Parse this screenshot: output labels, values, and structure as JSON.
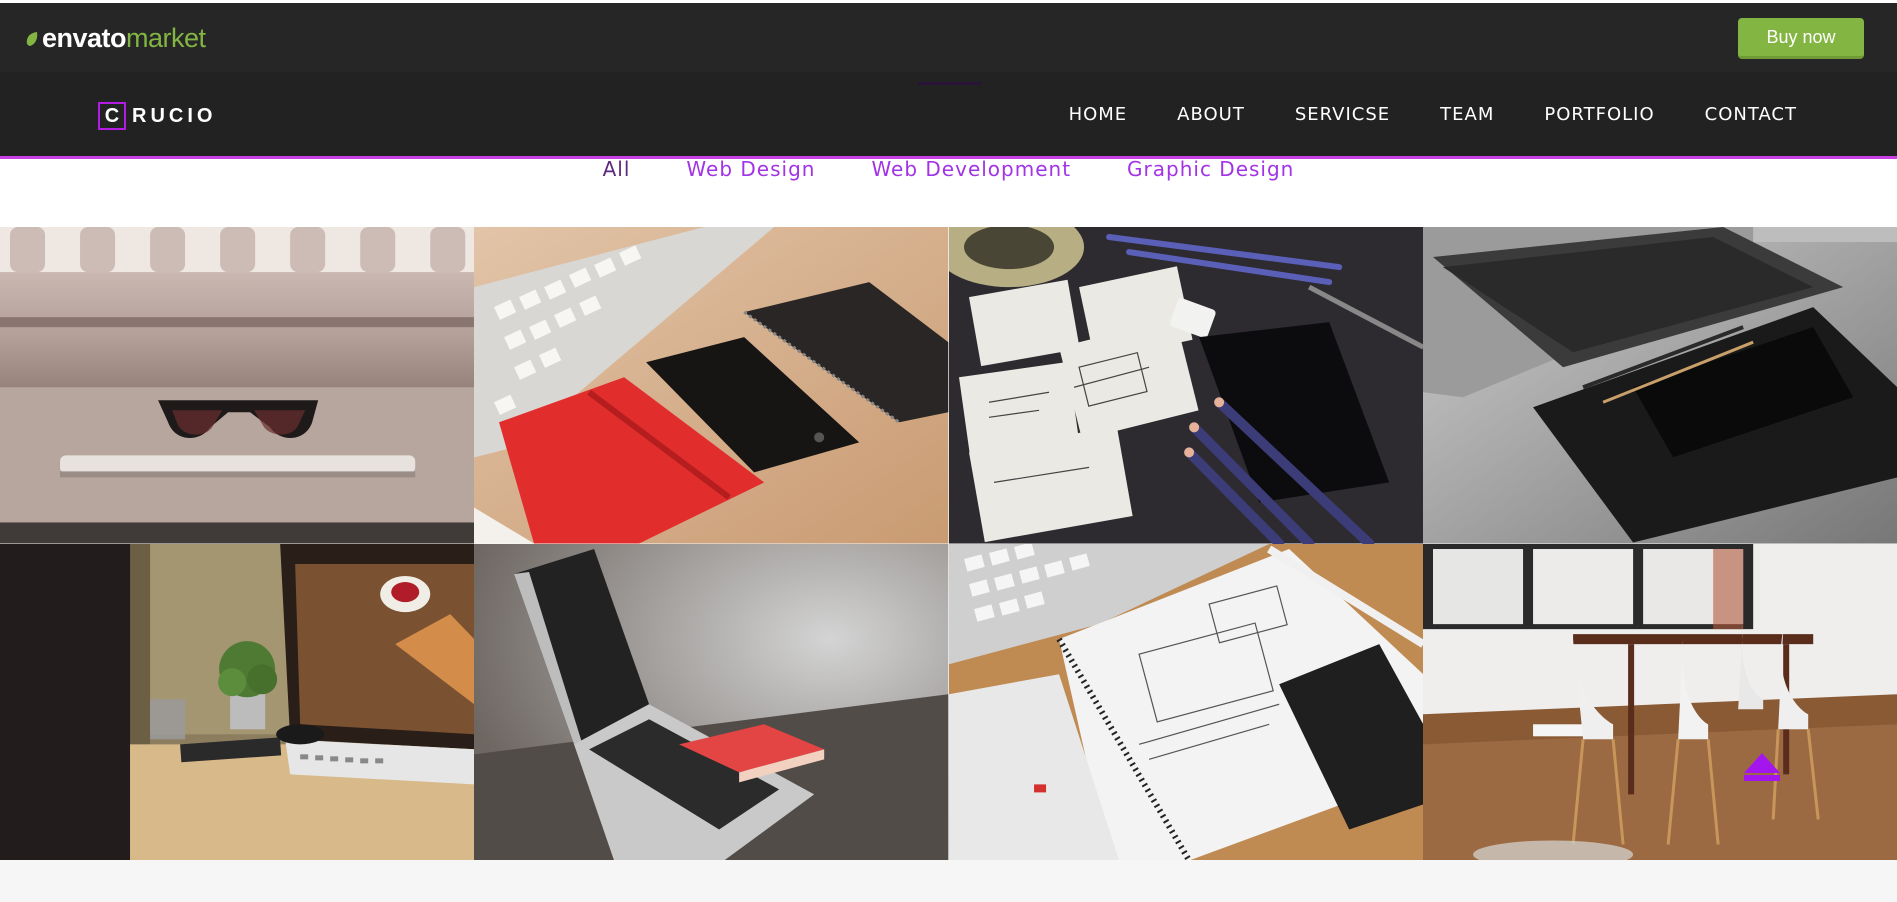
{
  "envato": {
    "brand_main": "envato",
    "brand_suffix": "market",
    "buy_label": "Buy now",
    "brand_color": "#82b541"
  },
  "site": {
    "logo_letter": "C",
    "logo_text": "RUCIO",
    "accent_color": "#b31ce6",
    "menu": [
      "HOME",
      "ABOUT",
      "SERVICSE",
      "TEAM",
      "PORTFOLIO",
      "CONTACT"
    ]
  },
  "portfolio": {
    "filters": [
      "All",
      "Web Design",
      "Web Development",
      "Graphic Design"
    ],
    "active_filter": "All",
    "tiles": [
      {
        "name": "sunglasses-on-laptop-photo"
      },
      {
        "name": "keyboard-notebooks-phone-photo"
      },
      {
        "name": "wireframe-sketches-pencils-photo"
      },
      {
        "name": "laptop-phone-on-notebook-photo"
      },
      {
        "name": "desk-monitor-plant-photo"
      },
      {
        "name": "laptop-red-notebook-photo"
      },
      {
        "name": "sketchbook-phone-keyboard-photo"
      },
      {
        "name": "white-chairs-dining-room-photo"
      }
    ]
  },
  "icons": {
    "scroll_top": "arrow-up-icon",
    "envato_leaf": "leaf-icon"
  }
}
